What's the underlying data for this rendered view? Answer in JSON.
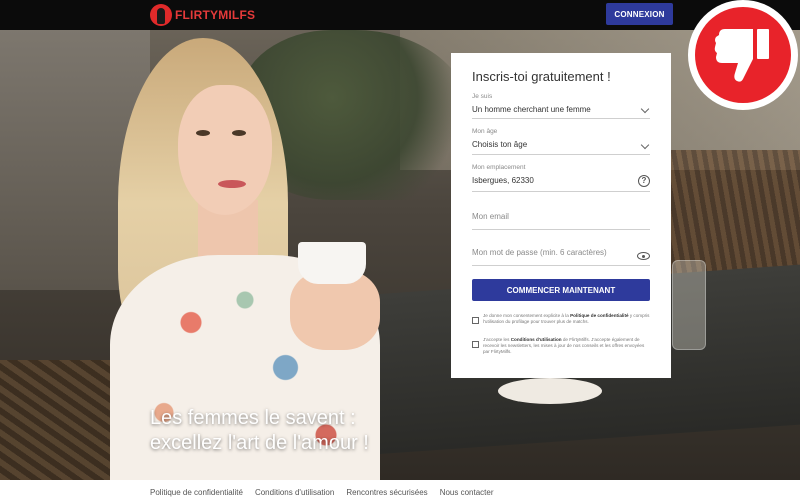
{
  "header": {
    "logo_text": "FLIRTYMILFS",
    "login_label": "CONNEXION"
  },
  "hero": {
    "tagline_line1": "Les femmes le savent :",
    "tagline_line2": "excellez l'art de l'amour !"
  },
  "signup": {
    "title": "Inscris-toi gratuitement !",
    "fields": {
      "gender": {
        "label": "Je suis",
        "value": "Un homme cherchant une femme"
      },
      "age": {
        "label": "Mon âge",
        "value": "Choisis ton âge"
      },
      "location": {
        "label": "Mon emplacement",
        "value": "Isbergues, 62330"
      },
      "email": {
        "placeholder": "Mon email"
      },
      "password": {
        "placeholder": "Mon mot de passe (min. 6 caractères)"
      }
    },
    "submit_label": "COMMENCER MAINTENANT",
    "consent1": {
      "pre": "Je donne mon consentement explicite à la",
      "link": "Politique de confidentialité",
      "post": "y compris l'utilisation du profilage pour trouver plus de matchs."
    },
    "consent2": {
      "pre": "J'accepte les",
      "link": "Conditions d'utilisation",
      "post": "de FlirtyMilfs. J'accepte également de recevoir les newsletters, les mises à jour de nos conseils et les offres envoyées par FlirtyMilfs."
    }
  },
  "footer": {
    "links": [
      "Politique de confidentialité",
      "Conditions d'utilisation",
      "Rencontres sécurisées",
      "Nous contacter"
    ]
  },
  "colors": {
    "accent": "#2e3a9c",
    "brand_red": "#e8232a",
    "topbar": "#0b0b0b"
  },
  "icons": {
    "logo": "woman-silhouette-icon",
    "gender_select": "chevron-down-icon",
    "age_select": "chevron-down-icon",
    "location_help": "question-circle-icon",
    "password_toggle": "eye-icon",
    "rating_badge": "thumbs-down-icon"
  }
}
